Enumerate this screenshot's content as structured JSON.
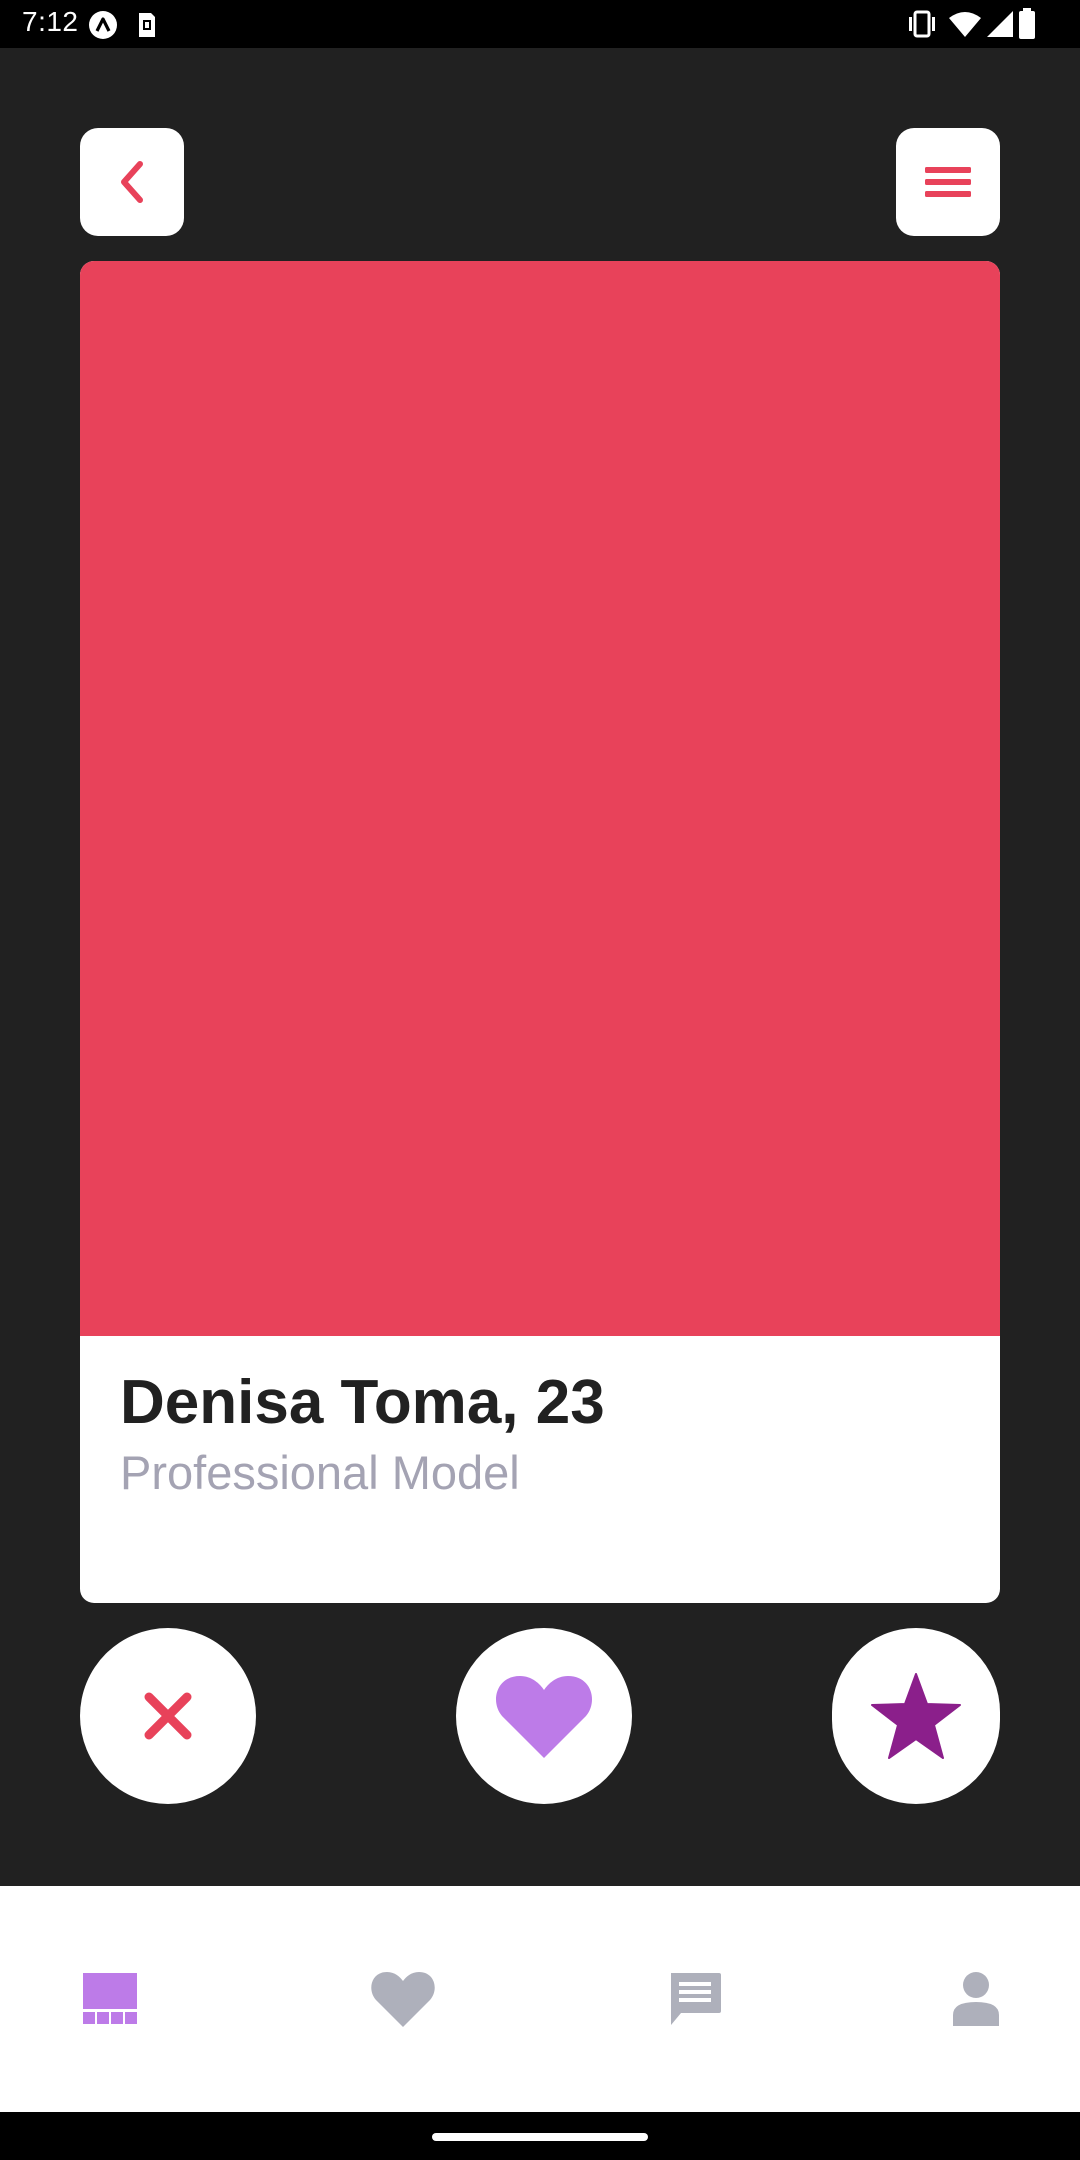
{
  "status_bar": {
    "time": "7:12"
  },
  "header": {
    "back_icon": "chevron-left-icon",
    "menu_icon": "hamburger-menu-icon"
  },
  "profile": {
    "name_age": "Denisa Toma, 23",
    "occupation": "Professional Model"
  },
  "actions": [
    {
      "name": "dislike",
      "icon": "close-icon"
    },
    {
      "name": "like",
      "icon": "heart-icon"
    },
    {
      "name": "super-like",
      "icon": "star-icon"
    }
  ],
  "tabs": [
    {
      "name": "explore",
      "icon": "grid-icon",
      "active": true
    },
    {
      "name": "matches",
      "icon": "heart-icon",
      "active": false
    },
    {
      "name": "messages",
      "icon": "chat-icon",
      "active": false
    },
    {
      "name": "profile",
      "icon": "person-icon",
      "active": false
    }
  ],
  "colors": {
    "background": "#212121",
    "accent_red": "#e8425a",
    "accent_purple": "#bd7be8",
    "accent_dark_purple": "#8b1f8b",
    "inactive_icon": "#aeb0bb",
    "subtitle_gray": "#a4a3b3"
  }
}
